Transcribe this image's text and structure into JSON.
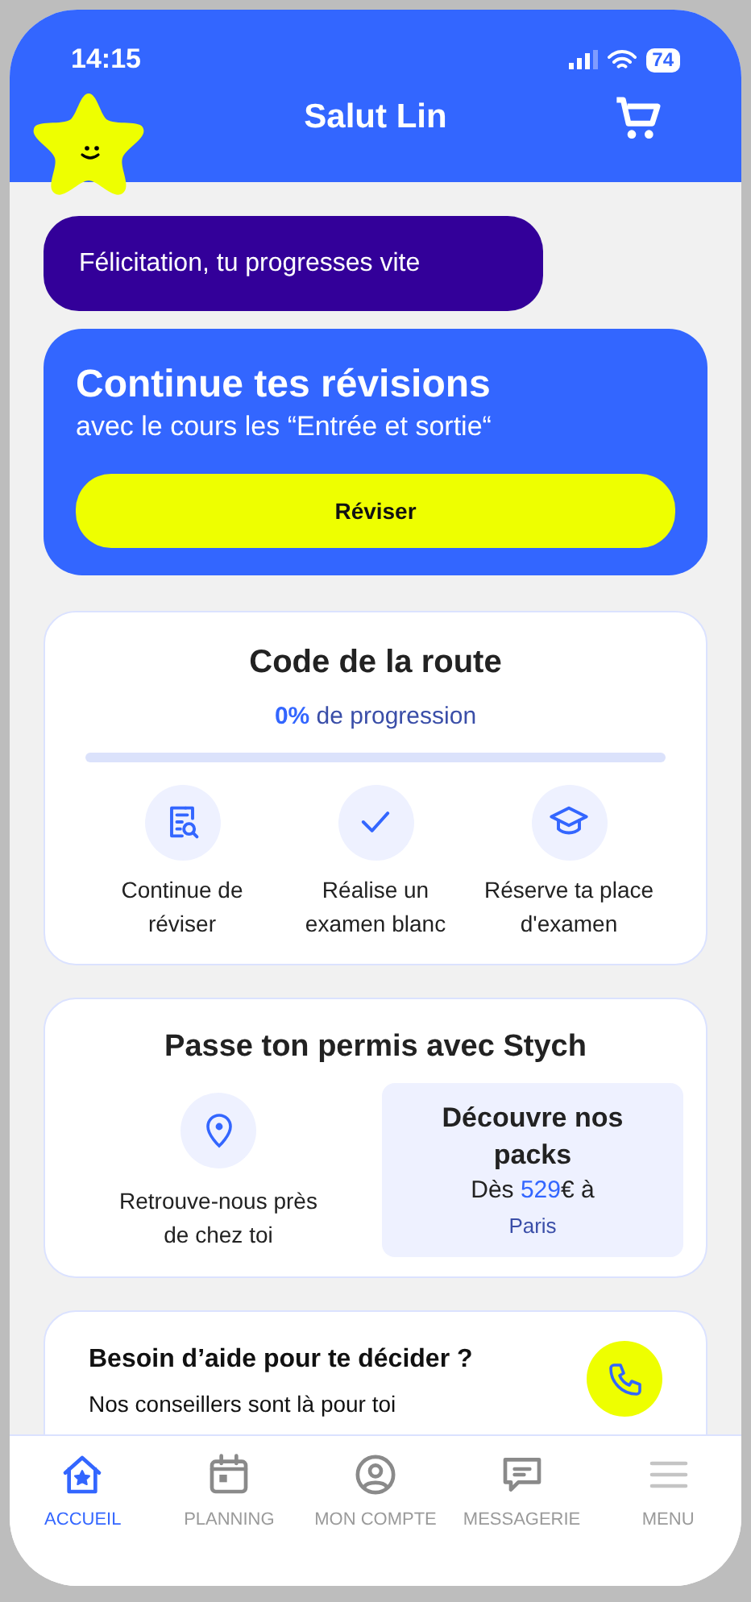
{
  "status_bar": {
    "time": "14:15",
    "battery": "74"
  },
  "header": {
    "title": "Salut Lin"
  },
  "banner": {
    "text": "Félicitation, tu progresses vite"
  },
  "revision_card": {
    "title": "Continue tes révisions",
    "subtitle": "avec le cours les “Entrée et sortie“",
    "button": "Réviser"
  },
  "code_card": {
    "title": "Code de la route",
    "progress_text": "**0%** de progression",
    "level": 0,
    "actions": [
      {
        "kind": "review",
        "label": "Continue de réviser"
      },
      {
        "kind": "exam",
        "label": "Réalise un examen blanc"
      },
      {
        "kind": "book",
        "label": "Réserve ta place d'examen"
      }
    ]
  },
  "permit_card": {
    "title": "Passe ton permis avec Stych",
    "location_label": "Retrouve-nous près de chez toi",
    "packs_title": "Découvre nos packs",
    "packs_price": "Dès **529**€ à",
    "packs_city": "Paris"
  },
  "help_card": {
    "title": "Besoin d’aide pour te décider ?",
    "subtitle": "Nos conseillers sont là pour toi"
  },
  "nav": [
    {
      "kind": "home",
      "label": "ACCUEIL",
      "selected": true
    },
    {
      "kind": "calendar",
      "label": "PLANNING",
      "selected": false
    },
    {
      "kind": "account",
      "label": "MON COMPTE",
      "selected": false
    },
    {
      "kind": "messages",
      "label": "MESSAGERIE",
      "selected": false
    },
    {
      "kind": "menu",
      "label": "MENU",
      "selected": false
    }
  ]
}
